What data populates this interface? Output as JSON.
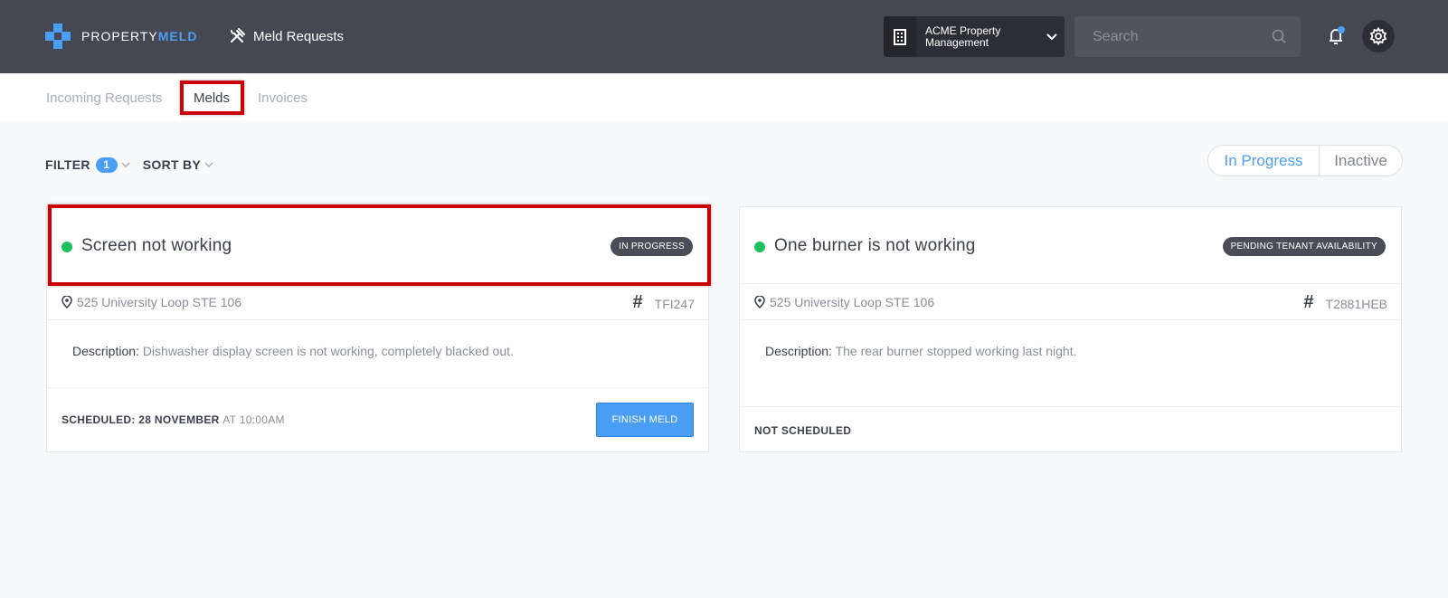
{
  "header": {
    "logo_prefix": "PROPERTY",
    "logo_suffix": "MELD",
    "app_title": "Meld Requests",
    "company_line1": "ACME Property",
    "company_line2": "Management",
    "search_placeholder": "Search"
  },
  "subnav": {
    "tabs": [
      {
        "label": "Incoming Requests",
        "active": false
      },
      {
        "label": "Melds",
        "active": true
      },
      {
        "label": "Invoices",
        "active": false
      }
    ]
  },
  "toolbar": {
    "filter_label": "FILTER",
    "filter_count": "1",
    "sort_label": "SORT BY",
    "status_options": [
      "In Progress",
      "Inactive"
    ],
    "status_selected": "In Progress"
  },
  "melds": [
    {
      "title": "Screen not working",
      "status": "IN PROGRESS",
      "address": "525 University Loop STE 106",
      "hash_symbol": "#",
      "number": "TFI247",
      "description_label": "Description:",
      "description": "Dishwasher display screen is not working, completely blacked out.",
      "schedule_label": "SCHEDULED: 28 NOVEMBER",
      "schedule_time": "AT 10:00AM",
      "action_label": "FINISH MELD"
    },
    {
      "title": "One burner is not working",
      "status": "PENDING TENANT AVAILABILITY",
      "address": "525 University Loop STE 106",
      "hash_symbol": "#",
      "number": "T2881HEB",
      "description_label": "Description:",
      "description": "The rear burner stopped working last night.",
      "schedule_label": "NOT SCHEDULED"
    }
  ],
  "colors": {
    "topbar": "#464851",
    "accent": "#4a9ff5",
    "status_dot": "#1fbf5f",
    "highlight": "#cc0000"
  }
}
